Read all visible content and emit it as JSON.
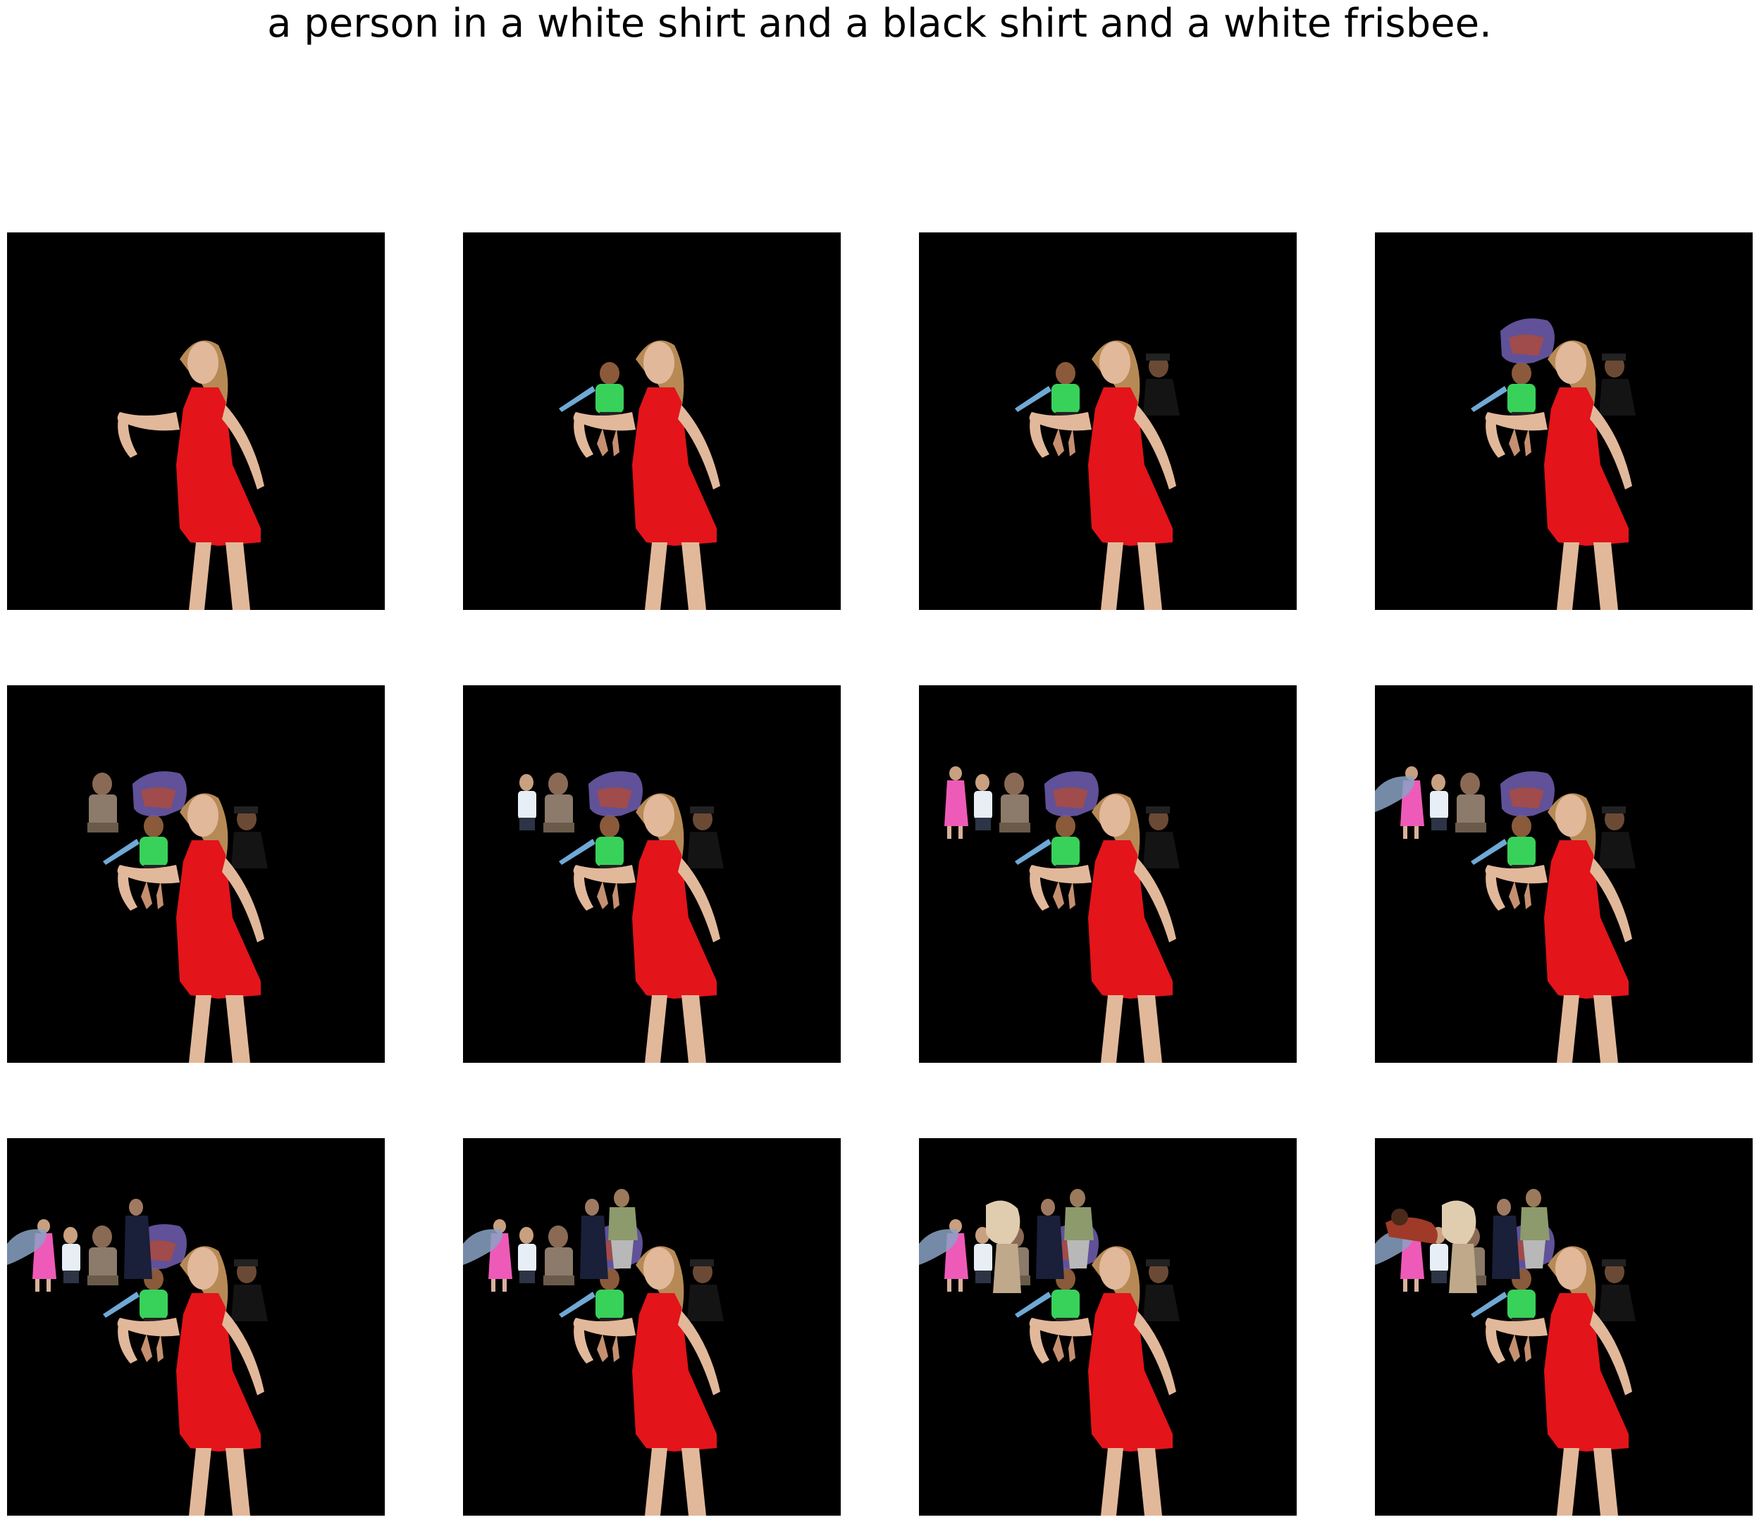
{
  "caption": "a person in a white shirt and a black shirt and a white frisbee.",
  "grid": {
    "rows": 3,
    "columns": 4,
    "background": "#000000"
  },
  "panels": [
    {
      "index": 1,
      "composited_cutouts": [
        "woman-red-dress"
      ]
    },
    {
      "index": 2,
      "composited_cutouts": [
        "woman-red-dress",
        "child-green-shirt"
      ]
    },
    {
      "index": 3,
      "composited_cutouts": [
        "woman-red-dress",
        "child-green-shirt",
        "man-dark-shirt"
      ]
    },
    {
      "index": 4,
      "composited_cutouts": [
        "woman-red-dress",
        "child-green-shirt",
        "man-dark-shirt",
        "purple-blob"
      ]
    },
    {
      "index": 5,
      "composited_cutouts": [
        "woman-red-dress",
        "child-green-shirt",
        "man-dark-shirt",
        "purple-blob",
        "seated-man"
      ]
    },
    {
      "index": 6,
      "composited_cutouts": [
        "woman-red-dress",
        "child-green-shirt",
        "man-dark-shirt",
        "purple-blob",
        "seated-man",
        "man-white-shirt"
      ]
    },
    {
      "index": 7,
      "composited_cutouts": [
        "woman-red-dress",
        "child-green-shirt",
        "man-dark-shirt",
        "purple-blob",
        "seated-man",
        "man-white-shirt",
        "pink-figure"
      ]
    },
    {
      "index": 8,
      "composited_cutouts": [
        "woman-red-dress",
        "child-green-shirt",
        "man-dark-shirt",
        "purple-blob",
        "seated-man",
        "man-white-shirt",
        "pink-figure",
        "blue-hand"
      ]
    },
    {
      "index": 9,
      "composited_cutouts": [
        "woman-red-dress",
        "child-green-shirt",
        "man-dark-shirt",
        "purple-blob",
        "seated-man",
        "man-white-shirt",
        "pink-figure",
        "blue-hand",
        "man-suit"
      ]
    },
    {
      "index": 10,
      "composited_cutouts": [
        "woman-red-dress",
        "child-green-shirt",
        "man-dark-shirt",
        "purple-blob",
        "seated-man",
        "man-white-shirt",
        "pink-figure",
        "blue-hand",
        "man-suit",
        "man-green-jacket"
      ]
    },
    {
      "index": 11,
      "composited_cutouts": [
        "woman-red-dress",
        "child-green-shirt",
        "man-dark-shirt",
        "purple-blob",
        "seated-man",
        "man-white-shirt",
        "pink-figure",
        "blue-hand",
        "man-suit",
        "man-green-jacket",
        "beige-figure"
      ]
    },
    {
      "index": 12,
      "composited_cutouts": [
        "woman-red-dress",
        "child-green-shirt",
        "man-dark-shirt",
        "purple-blob",
        "seated-man",
        "man-white-shirt",
        "pink-figure",
        "blue-hand",
        "man-suit",
        "man-green-jacket",
        "beige-figure",
        "red-brown-figure"
      ]
    }
  ]
}
